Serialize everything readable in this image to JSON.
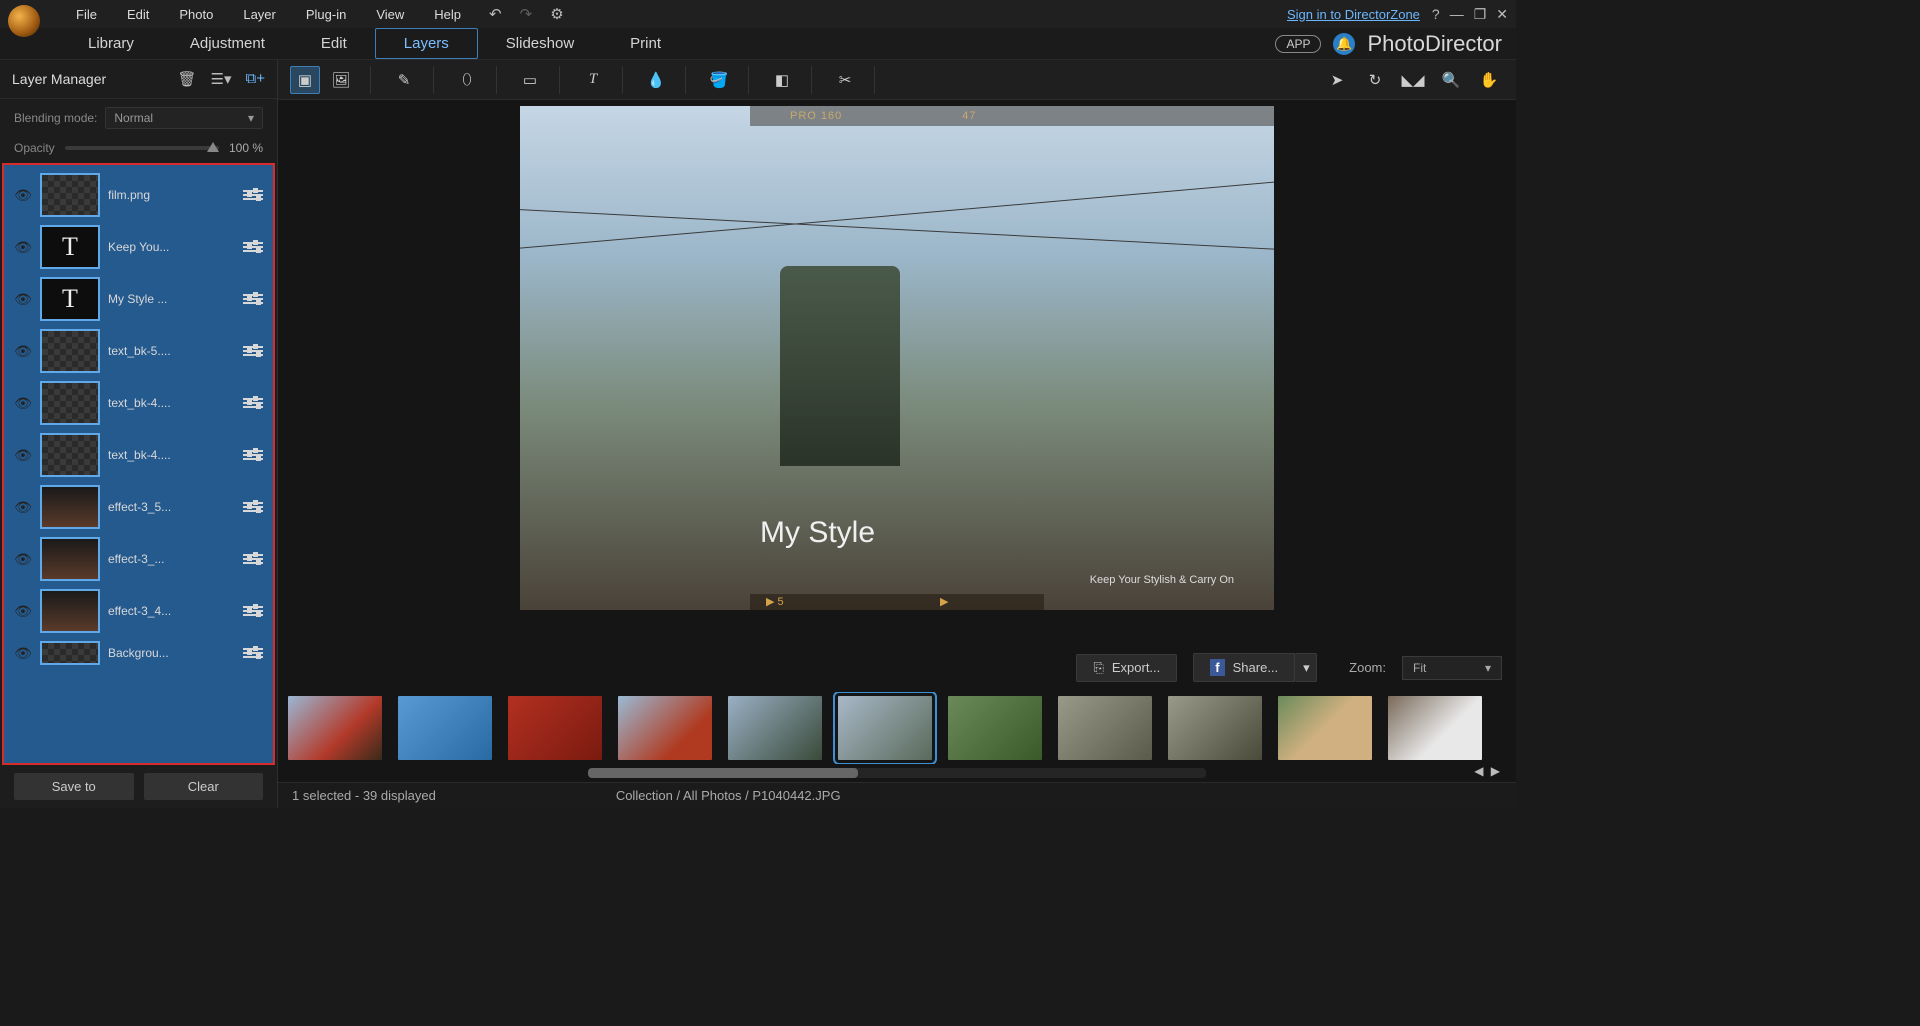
{
  "menu": [
    "File",
    "Edit",
    "Photo",
    "Layer",
    "Plug-in",
    "View",
    "Help"
  ],
  "top_right": {
    "signin": "Sign in to DirectorZone"
  },
  "tabs": [
    "Library",
    "Adjustment",
    "Edit",
    "Layers",
    "Slideshow",
    "Print"
  ],
  "active_tab": "Layers",
  "app_pill": "APP",
  "brand": "PhotoDirector",
  "layer_manager": {
    "title": "Layer Manager",
    "blending_label": "Blending mode:",
    "blending_value": "Normal",
    "opacity_label": "Opacity",
    "opacity_value": "100 %"
  },
  "layers": [
    {
      "name": "film.png",
      "type": "checker"
    },
    {
      "name": "Keep You...",
      "type": "text"
    },
    {
      "name": "My Style  ...",
      "type": "text"
    },
    {
      "name": "text_bk-5....",
      "type": "checker"
    },
    {
      "name": "text_bk-4....",
      "type": "checker"
    },
    {
      "name": "text_bk-4....",
      "type": "checker"
    },
    {
      "name": "effect-3_5...",
      "type": "effect"
    },
    {
      "name": "effect-3_...",
      "type": "effect"
    },
    {
      "name": "effect-3_4...",
      "type": "effect"
    },
    {
      "name": "Backgrou...",
      "type": "small"
    }
  ],
  "sidebar_footer": {
    "save_to": "Save to",
    "clear": "Clear"
  },
  "canvas": {
    "film_a": "PRO 160",
    "film_b": "47",
    "my_style": "My Style",
    "keep": "Keep Your Stylish & Carry On",
    "arrow_l": "▶ 5",
    "arrow_r": "▶"
  },
  "actions": {
    "export": "Export...",
    "share": "Share...",
    "zoom_label": "Zoom:",
    "zoom_value": "Fit"
  },
  "status": {
    "selection": "1 selected - 39 displayed",
    "path": "Collection / All Photos / P1040442.JPG"
  }
}
